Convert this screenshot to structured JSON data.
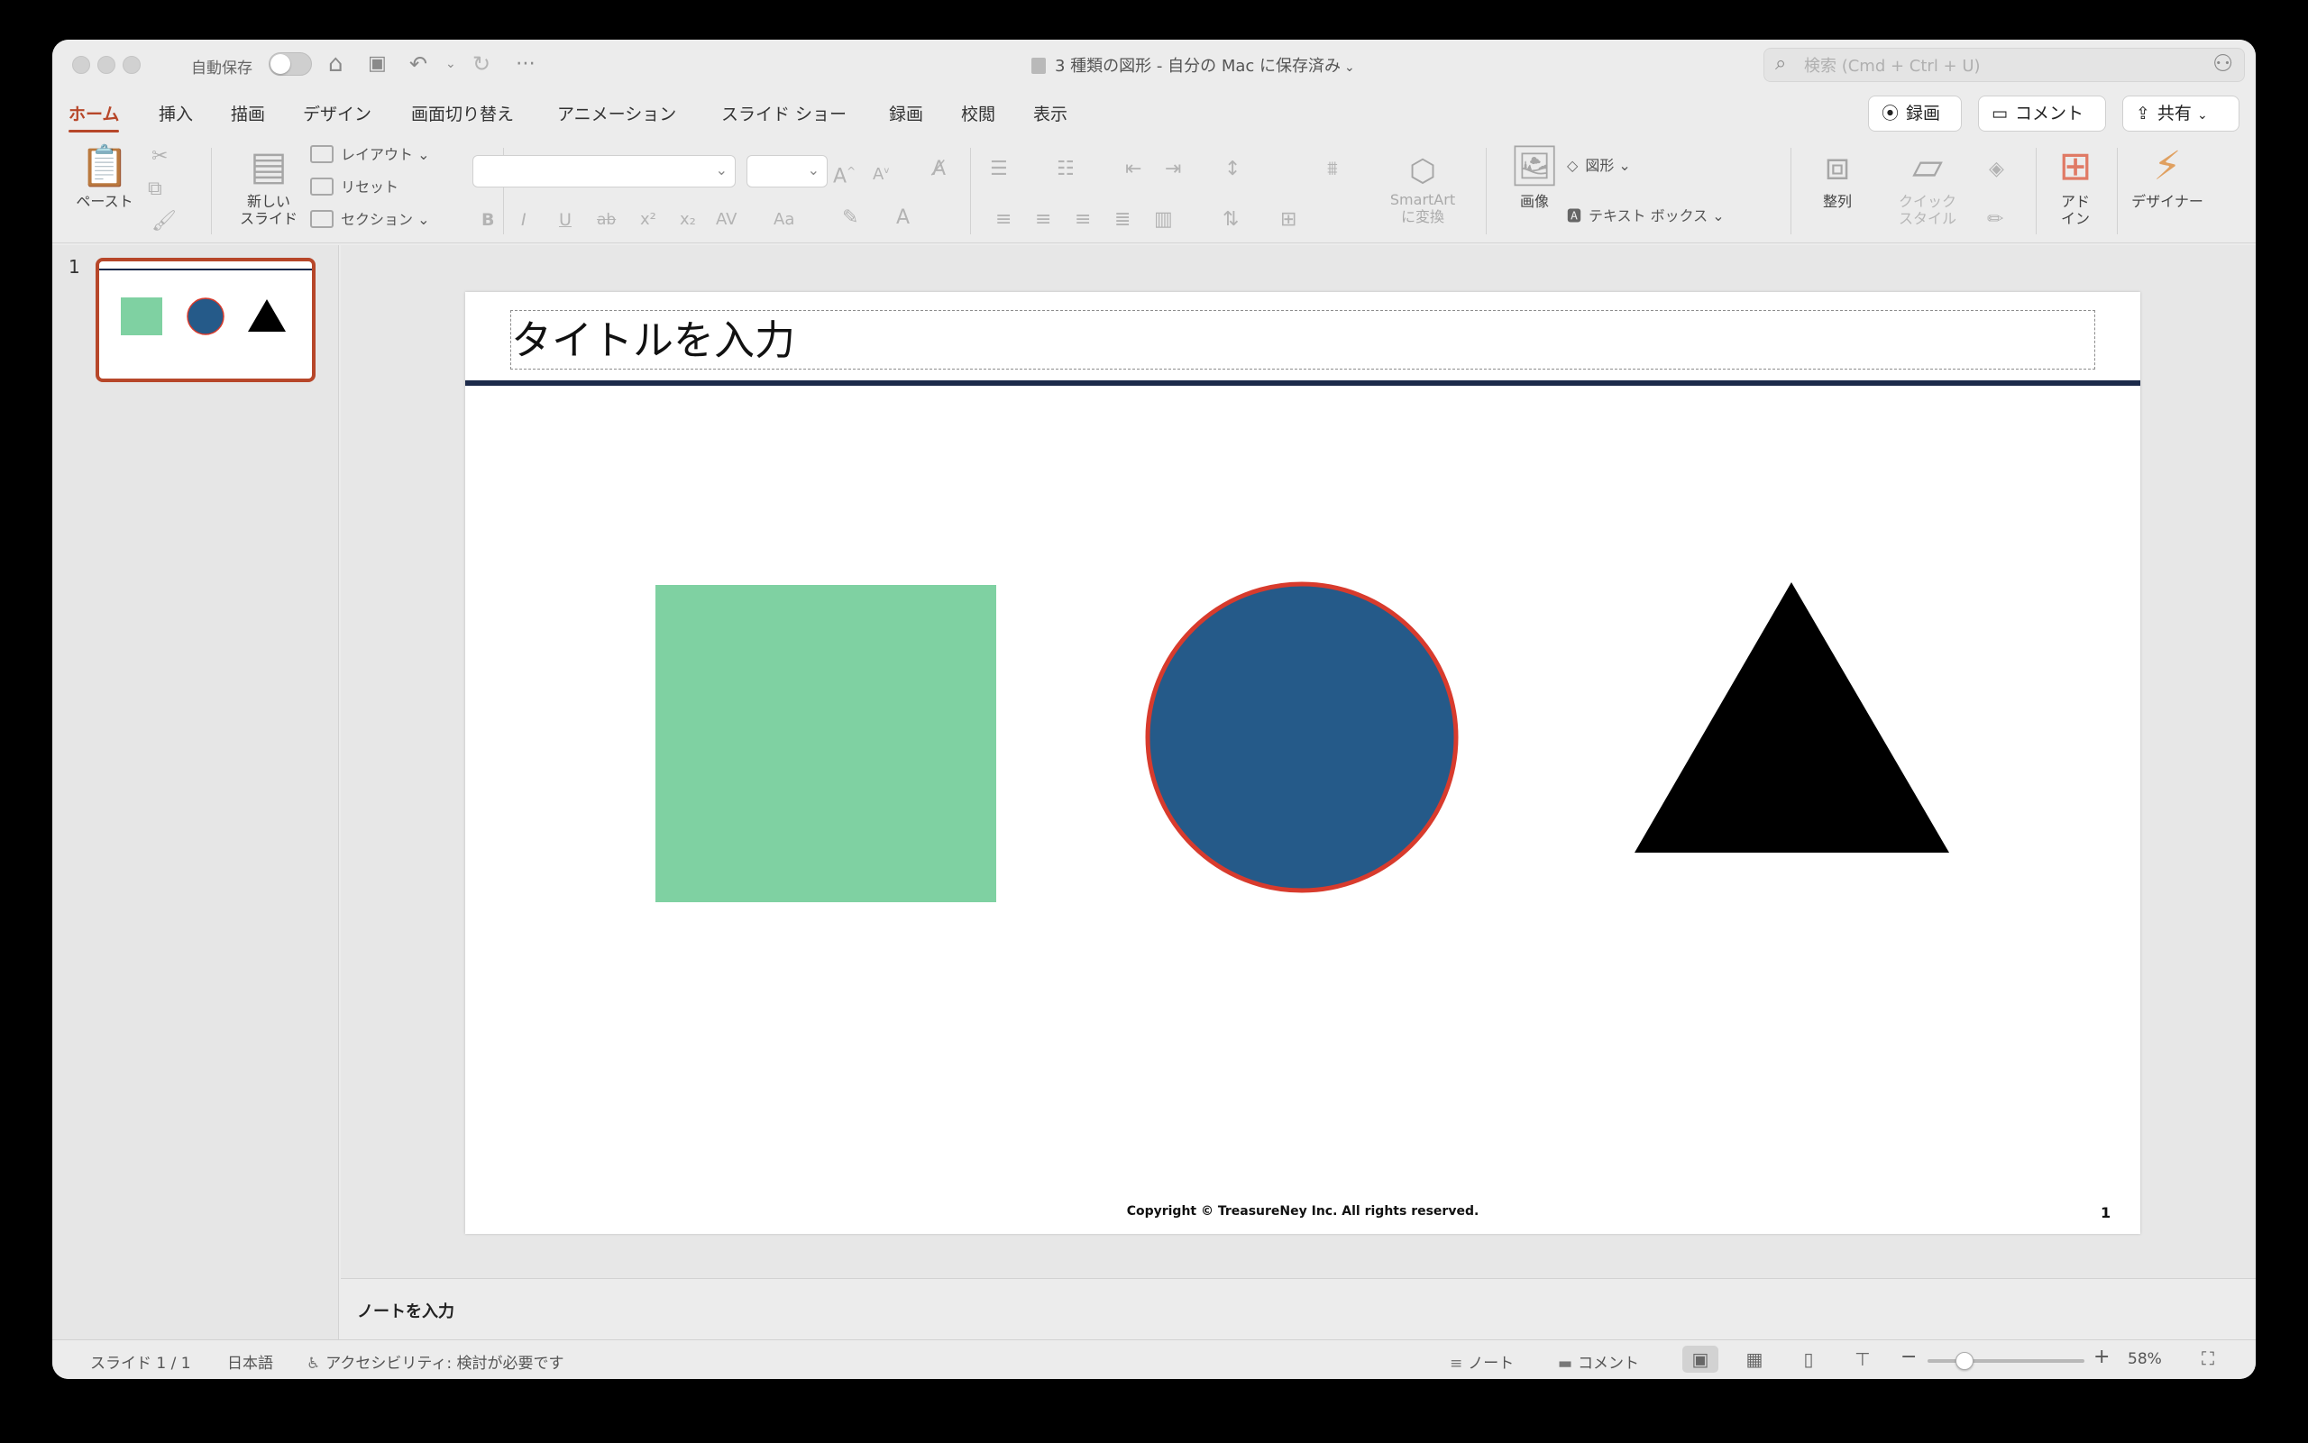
{
  "titlebar": {
    "autosave_label": "自動保存",
    "document_title": "3 種類の図形 - 自分の Mac に保存済み",
    "search_placeholder": "検索 (Cmd + Ctrl + U)"
  },
  "tabs": [
    {
      "label": "ホーム",
      "active": true
    },
    {
      "label": "挿入"
    },
    {
      "label": "描画"
    },
    {
      "label": "デザイン"
    },
    {
      "label": "画面切り替え"
    },
    {
      "label": "アニメーション"
    },
    {
      "label": "スライド ショー"
    },
    {
      "label": "録画"
    },
    {
      "label": "校閲"
    },
    {
      "label": "表示"
    }
  ],
  "actions": {
    "record": "録画",
    "comment": "コメント",
    "share": "共有"
  },
  "ribbon": {
    "paste": "ペースト",
    "new_slide_1": "新しい",
    "new_slide_2": "スライド",
    "layout": "レイアウト",
    "reset": "リセット",
    "section": "セクション",
    "smartart_1": "SmartArt",
    "smartart_2": "に変換",
    "picture": "画像",
    "shapes": "図形",
    "textbox": "テキスト ボックス",
    "arrange": "整列",
    "quick_style_1": "クイック",
    "quick_style_2": "スタイル",
    "addins_1": "アド",
    "addins_2": "イン",
    "designer": "デザイナー"
  },
  "thumbnails": {
    "slide_number": "1"
  },
  "slide": {
    "title": "タイトルを入力",
    "copyright": "Copyright © TreasureNey Inc. All rights reserved.",
    "page_number": "1",
    "shapes": {
      "square_fill": "#7fd1a2",
      "circle_fill": "#255a89",
      "circle_stroke": "#d83b2d",
      "triangle_fill": "#000000",
      "title_rule": "#1c2a4a"
    }
  },
  "notes": {
    "placeholder": "ノートを入力"
  },
  "statusbar": {
    "slide_indicator": "スライド 1 / 1",
    "language": "日本語",
    "accessibility": "アクセシビリティ: 検討が必要です",
    "notes": "ノート",
    "comments": "コメント",
    "zoom_minus": "−",
    "zoom_plus": "+",
    "zoom": "58%",
    "zoom_fraction": 0.2
  },
  "theme": {
    "accent": "#b7472a"
  }
}
